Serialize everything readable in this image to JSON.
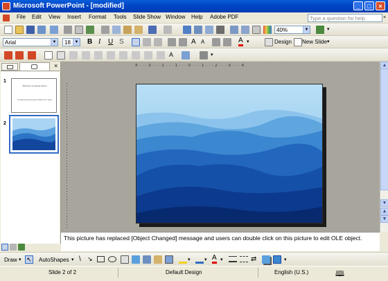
{
  "window": {
    "title": "Microsoft PowerPoint - [modified]"
  },
  "menu": {
    "items": [
      "File",
      "Edit",
      "View",
      "Insert",
      "Format",
      "Tools",
      "Slide Show",
      "Window",
      "Help",
      "Adobe PDF"
    ],
    "ask_placeholder": "Type a question for help"
  },
  "standard_toolbar": {
    "zoom": "40%"
  },
  "formatting_toolbar": {
    "font": "Arial",
    "size": "18",
    "design_label": "Design",
    "new_slide_label": "New Slide"
  },
  "slides_pane": {
    "thumbnails": [
      {
        "number": "1",
        "title": "Welcome to Aspose Demo",
        "subtitle": "Created using Aspose.Slides for Java"
      },
      {
        "number": "2"
      }
    ]
  },
  "ruler": {
    "horizontal": "4 · · · 3 · · · 2 · · · 1 · · · 0 · · · 1 · · · 2 · · · 3 · · · 4"
  },
  "notes": {
    "text": "This picture has replaced [Object Changed] message and users can double click on this picture to edit OLE object."
  },
  "drawing_toolbar": {
    "draw_label": "Draw",
    "autoshapes_label": "AutoShapes"
  },
  "status": {
    "slide": "Slide 2 of 2",
    "design": "Default Design",
    "language": "English (U.S.)"
  },
  "colors": {
    "title_blue": "#0046c8",
    "slide_bg": "#a7a59c",
    "mountain_top": "#8fc2ea",
    "mountain_bottom": "#0c2e8a"
  }
}
